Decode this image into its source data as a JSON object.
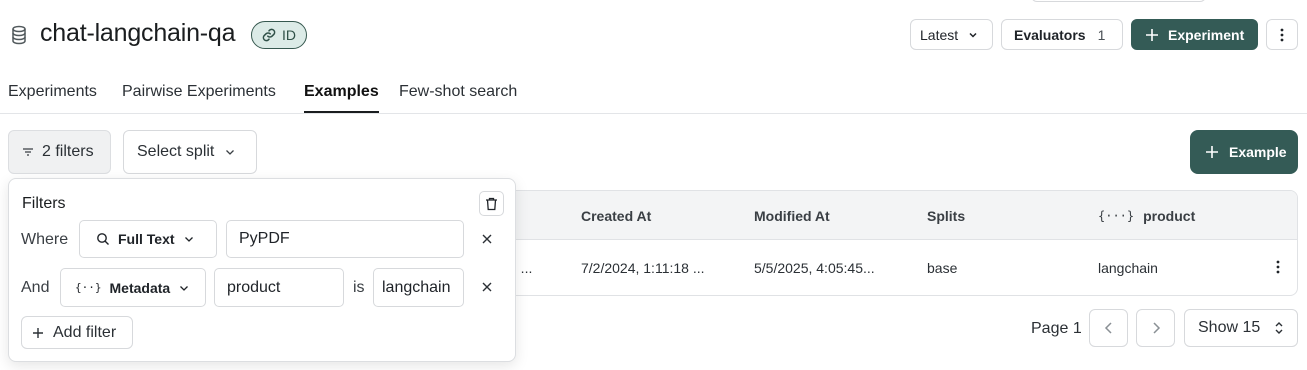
{
  "header": {
    "title": "chat-langchain-qa",
    "id_badge": "ID",
    "latest_label": "Latest",
    "evaluators_label": "Evaluators",
    "evaluators_count": "1",
    "experiment_label": "Experiment"
  },
  "tabs": [
    {
      "label": "Experiments"
    },
    {
      "label": "Pairwise Experiments"
    },
    {
      "label": "Examples",
      "active": true
    },
    {
      "label": "Few-shot search"
    }
  ],
  "toolbar": {
    "filters_label": "2 filters",
    "split_label": "Select split",
    "example_label": "Example"
  },
  "table": {
    "headers": [
      "Created At",
      "Modified At",
      "Splits",
      "product"
    ],
    "rows": [
      {
        "truncated_prefix": "n ...",
        "created_at": "7/2/2024, 1:11:18 ...",
        "modified_at": "5/5/2025, 4:05:45...",
        "splits": "base",
        "product": "langchain"
      }
    ]
  },
  "pagination": {
    "page_label": "Page 1",
    "show_label": "Show 15"
  },
  "filter_popover": {
    "title": "Filters",
    "rows": [
      {
        "connector": "Where",
        "type": "Full Text",
        "value": "PyPDF"
      },
      {
        "connector": "And",
        "type": "Metadata",
        "key": "product",
        "operator": "is",
        "value": "langchain"
      }
    ],
    "add_label": "Add filter"
  },
  "colors": {
    "primary": "#345b56",
    "badge_bg": "#dcebe7"
  }
}
